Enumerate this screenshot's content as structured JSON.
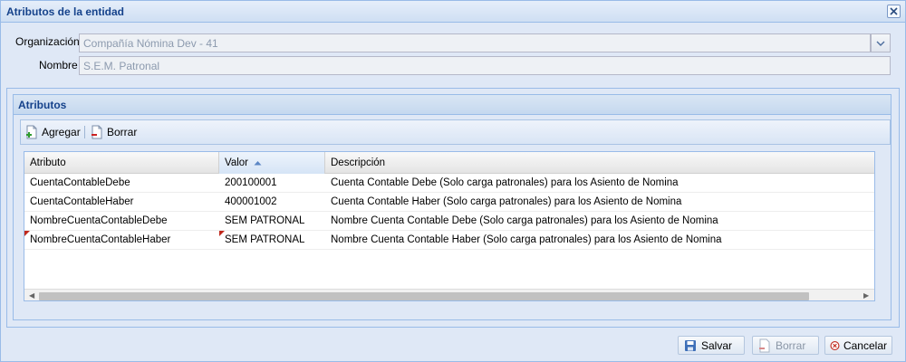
{
  "window": {
    "title": "Atributos de la entidad"
  },
  "form": {
    "organizacion_label": "Organización",
    "organizacion_value": "Compañía Nómina Dev - 41",
    "nombre_label": "Nombre",
    "nombre_value": "S.E.M. Patronal"
  },
  "panel": {
    "title": "Atributos"
  },
  "toolbar": {
    "add_label": "Agregar",
    "delete_label": "Borrar"
  },
  "grid": {
    "columns": [
      "Atributo",
      "Valor",
      "Descripción"
    ],
    "sorted_column": "Valor",
    "sort_direction": "asc",
    "rows": [
      {
        "atributo": "CuentaContableDebe",
        "valor": "200100001",
        "descripcion": "Cuenta Contable Debe (Solo carga patronales) para los Asiento de Nomina",
        "dirty": false
      },
      {
        "atributo": "CuentaContableHaber",
        "valor": "400001002",
        "descripcion": "Cuenta Contable Haber (Solo carga patronales) para los Asiento de Nomina",
        "dirty": false
      },
      {
        "atributo": "NombreCuentaContableDebe",
        "valor": "SEM PATRONAL",
        "descripcion": "Nombre Cuenta Contable Debe (Solo carga patronales) para los Asiento de Nomina",
        "dirty": false
      },
      {
        "atributo": "NombreCuentaContableHaber",
        "valor": "SEM PATRONAL",
        "descripcion": "Nombre Cuenta Contable Haber (Solo carga patronales) para los Asiento de Nomina",
        "dirty": true
      }
    ]
  },
  "footer": {
    "save_label": "Salvar",
    "delete_label": "Borrar",
    "cancel_label": "Cancelar"
  },
  "colors": {
    "title": "#15428b",
    "window_bg": "#dfe8f6",
    "border": "#99bbe8",
    "dirty_marker": "#c0281c"
  }
}
